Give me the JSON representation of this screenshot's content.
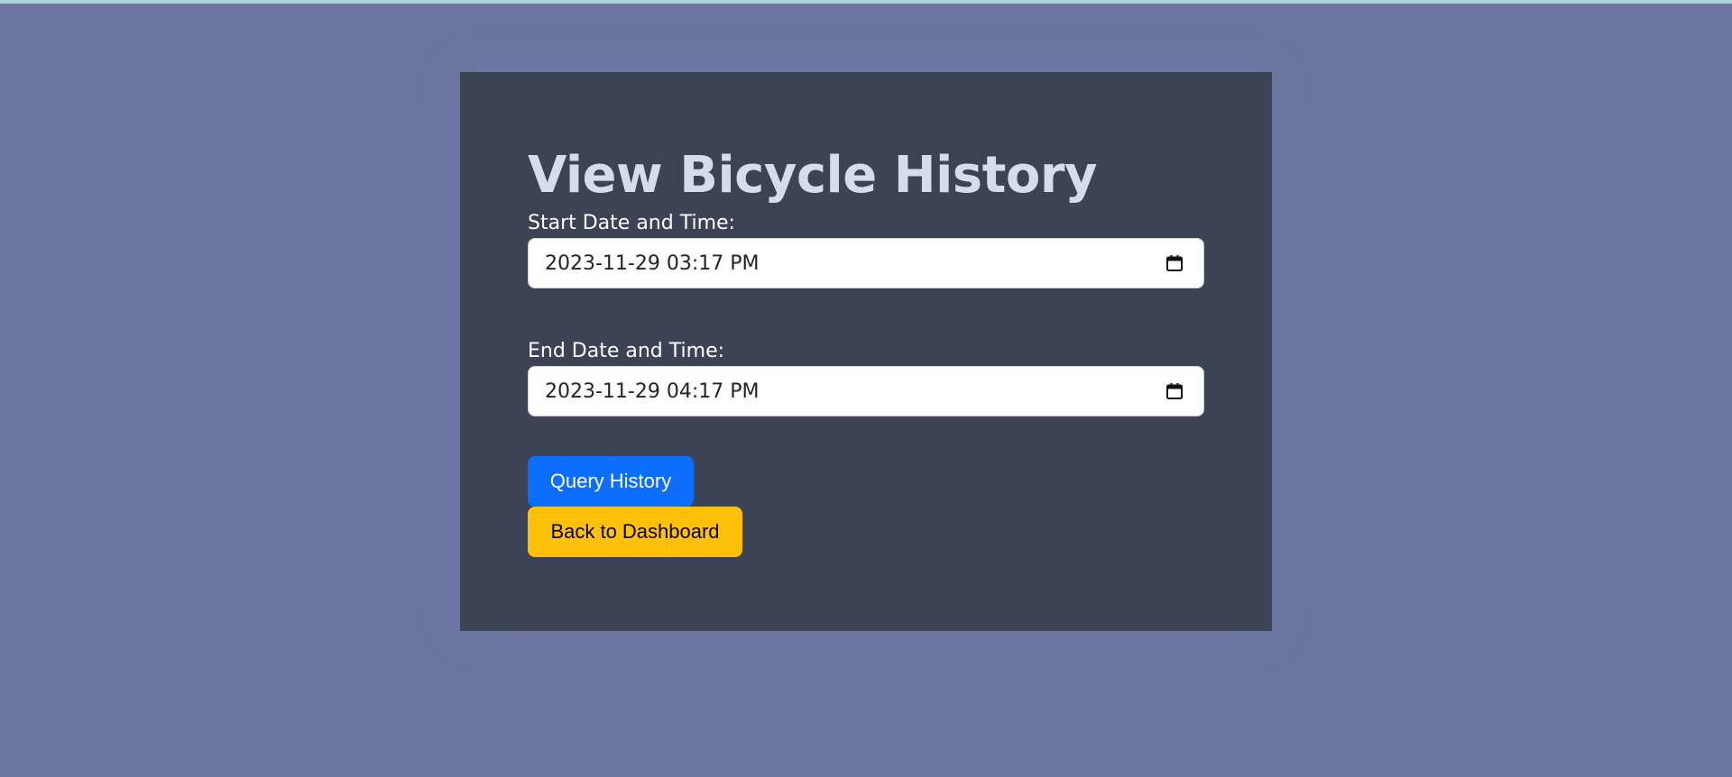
{
  "page": {
    "title": "View Bicycle History"
  },
  "form": {
    "start": {
      "label": "Start Date and Time:",
      "value": "2023-11-29 03:17 PM"
    },
    "end": {
      "label": "End Date and Time:",
      "value": "2023-11-29 04:17 PM"
    },
    "query_button": "Query History",
    "back_button": "Back to Dashboard"
  },
  "icons": {
    "calendar": "calendar-icon"
  },
  "colors": {
    "background": "#6c74a0",
    "card": "#3c4354",
    "primary": "#0d6efd",
    "warning": "#ffc107"
  }
}
